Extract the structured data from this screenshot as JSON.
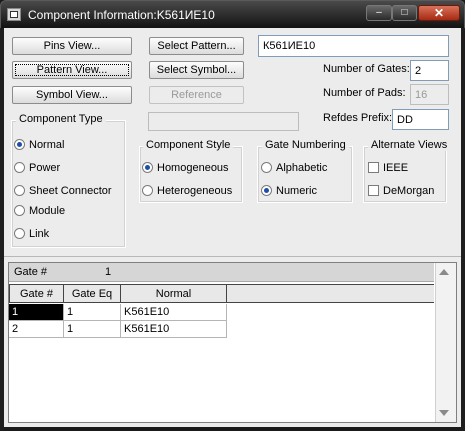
{
  "window": {
    "title": "Component Information:K561ИЕ10",
    "minimize": "–",
    "maximize": "□",
    "close": "✕"
  },
  "buttons": {
    "pins_view": "Pins View...",
    "pattern_view": "Pattern View...",
    "symbol_view": "Symbol View...",
    "select_pattern": "Select Pattern...",
    "select_symbol": "Select Symbol...",
    "reference": "Reference"
  },
  "fields": {
    "component_name": "К561ИЕ10",
    "reference_value": "",
    "number_of_gates_label": "Number of Gates:",
    "number_of_gates": "2",
    "number_of_pads_label": "Number of Pads:",
    "number_of_pads": "16",
    "refdes_prefix_label": "Refdes Prefix:",
    "refdes_prefix": "DD"
  },
  "component_type": {
    "title": "Component Type",
    "options": [
      "Normal",
      "Power",
      "Sheet Connector",
      "Module",
      "Link"
    ],
    "selected": "Normal"
  },
  "component_style": {
    "title": "Component Style",
    "options": [
      "Homogeneous",
      "Heterogeneous"
    ],
    "selected": "Homogeneous"
  },
  "gate_numbering": {
    "title": "Gate Numbering",
    "options": [
      "Alphabetic",
      "Numeric"
    ],
    "selected": "Numeric"
  },
  "alternate_views": {
    "title": "Alternate Views",
    "options": [
      "IEEE",
      "DeMorgan"
    ],
    "checked": []
  },
  "grid": {
    "gate_label": "Gate #",
    "gate_value": "1",
    "columns": [
      "Gate #",
      "Gate Eq",
      "Normal"
    ],
    "rows": [
      [
        "1",
        "1",
        "K561E10"
      ],
      [
        "2",
        "1",
        "K561E10"
      ]
    ]
  }
}
